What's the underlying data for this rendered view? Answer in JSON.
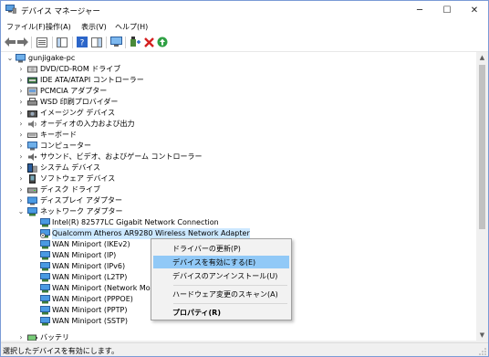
{
  "window": {
    "title": "デバイス マネージャー"
  },
  "menu": [
    "ファイル(F)",
    "操作(A)",
    "表示(V)",
    "ヘルプ(H)"
  ],
  "caption_buttons": {
    "minimize": "─",
    "maximize": "☐",
    "close": "✕"
  },
  "tree": {
    "root": "gunjigake-pc",
    "rows": [
      {
        "label": "DVD/CD-ROM ドライブ",
        "icon": "dvd-drive-icon"
      },
      {
        "label": "IDE ATA/ATAPI コントローラー",
        "icon": "ide-controller-icon"
      },
      {
        "label": "PCMCIA アダプター",
        "icon": "pcmcia-icon"
      },
      {
        "label": "WSD 印刷プロバイダー",
        "icon": "printer-icon"
      },
      {
        "label": "イメージング デバイス",
        "icon": "camera-icon"
      },
      {
        "label": "オーディオの入力および出力",
        "icon": "speaker-icon"
      },
      {
        "label": "キーボード",
        "icon": "keyboard-icon"
      },
      {
        "label": "コンピューター",
        "icon": "computer-icon"
      },
      {
        "label": "サウンド、ビデオ、およびゲーム コントローラー",
        "icon": "sound-icon"
      },
      {
        "label": "システム デバイス",
        "icon": "system-device-icon"
      },
      {
        "label": "ソフトウェア デバイス",
        "icon": "software-device-icon"
      },
      {
        "label": "ディスク ドライブ",
        "icon": "disk-drive-icon"
      },
      {
        "label": "ディスプレイ アダプター",
        "icon": "display-adapter-icon"
      },
      {
        "label": "ネットワーク アダプター",
        "icon": "network-adapter-icon",
        "expanded": true
      }
    ],
    "network_children": [
      "Intel(R) 82577LC Gigabit Network Connection",
      "Qualcomm Atheros AR9280 Wireless Network Adapter",
      "WAN Miniport (IKEv2)",
      "WAN Miniport (IP)",
      "WAN Miniport (IPv6)",
      "WAN Miniport (L2TP)",
      "WAN Miniport (Network Monitor)",
      "WAN Miniport (PPPOE)",
      "WAN Miniport (PPTP)",
      "WAN Miniport (SSTP)"
    ],
    "last_partial": "バッテリ"
  },
  "context_menu": {
    "items": [
      {
        "label": "ドライバーの更新(P)"
      },
      {
        "label": "デバイスを有効にする(E)",
        "highlighted": true
      },
      {
        "label": "デバイスのアンインストール(U)"
      },
      {
        "label": "ハードウェア変更のスキャン(A)"
      },
      {
        "label": "プロパティ(R)",
        "bold": true
      }
    ]
  },
  "status_bar": {
    "text": "選択したデバイスを有効にします。"
  },
  "colors": {
    "selection": "#cce8ff",
    "menu_highlight": "#91c9f7",
    "accent": "#0078d7"
  }
}
